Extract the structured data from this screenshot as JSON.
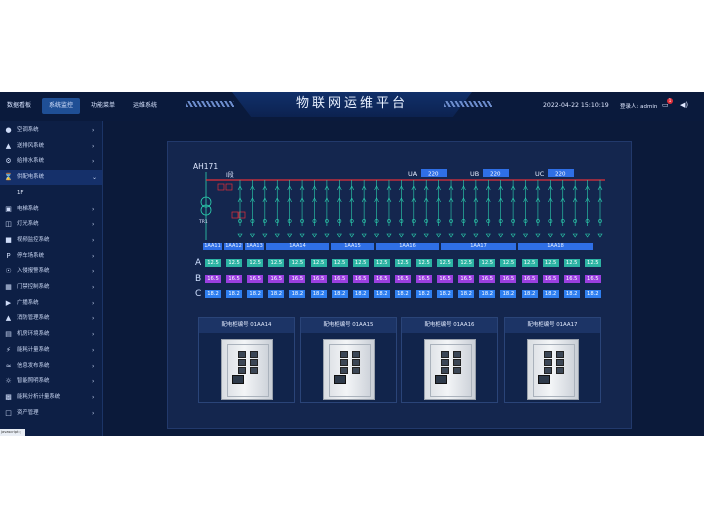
{
  "header": {
    "nav": [
      "数据看板",
      "系统监控",
      "功能菜单",
      "运维系统"
    ],
    "active_nav": "系统监控",
    "title": "物联网运维平台",
    "datetime": "2022-04-22 15:10:19",
    "user": "登录人: admin",
    "notification_count": "1"
  },
  "sidebar": {
    "items": [
      {
        "label": "空调系统",
        "icon": "group-icon"
      },
      {
        "label": "送排风系统",
        "icon": "warning-icon"
      },
      {
        "label": "给排水系统",
        "icon": "gear-icon"
      },
      {
        "label": "供配电系统",
        "icon": "hourglass-icon",
        "expanded": true
      },
      {
        "label": "电梯系统",
        "icon": "monitor-icon"
      },
      {
        "label": "灯光系统",
        "icon": "database-icon"
      },
      {
        "label": "视频监控系统",
        "icon": "video-icon"
      },
      {
        "label": "停车场系统",
        "icon": "parking-icon"
      },
      {
        "label": "入侵报警系统",
        "icon": "alarm-icon"
      },
      {
        "label": "门禁控制系统",
        "icon": "door-icon"
      },
      {
        "label": "广播系统",
        "icon": "broadcast-icon"
      },
      {
        "label": "消防管理系统",
        "icon": "fire-icon"
      },
      {
        "label": "机房环境系统",
        "icon": "server-icon"
      },
      {
        "label": "能耗计量系统",
        "icon": "energy-icon"
      },
      {
        "label": "信息发布系统",
        "icon": "wifi-icon"
      },
      {
        "label": "智能照明系统",
        "icon": "light-icon"
      },
      {
        "label": "能耗分析计量系统",
        "icon": "analysis-icon"
      },
      {
        "label": "资产管理",
        "icon": "asset-icon"
      }
    ],
    "sub_item": "1F",
    "status_url": "javascript:;"
  },
  "diagram": {
    "incoming_label": "AH171",
    "bus_label": "I段",
    "transformer_label": "TR1",
    "voltages": [
      {
        "name": "UA",
        "value": "220"
      },
      {
        "name": "UB",
        "value": "220"
      },
      {
        "name": "UC",
        "value": "220"
      }
    ],
    "bus_sections": [
      "1AA11",
      "1AA12",
      "1AA13",
      "1AA14",
      "1AA15",
      "1AA16",
      "1AA17",
      "1AA18"
    ],
    "phases": [
      {
        "label": "A",
        "value": "12.5",
        "count": 19
      },
      {
        "label": "B",
        "value": "16.5",
        "count": 19
      },
      {
        "label": "C",
        "value": "18.2",
        "count": 19
      }
    ],
    "colors": {
      "bus": "#e0303a",
      "breaker": "#2cd3b0",
      "phase_a": "#2cb3a3",
      "phase_b": "#9b3fe0",
      "phase_c": "#2f7ff0"
    }
  },
  "cabinets": [
    {
      "label": "配电柜编号 01AA14"
    },
    {
      "label": "配电柜编号 01AA15"
    },
    {
      "label": "配电柜编号 01AA16"
    },
    {
      "label": "配电柜编号 01AA17"
    }
  ]
}
